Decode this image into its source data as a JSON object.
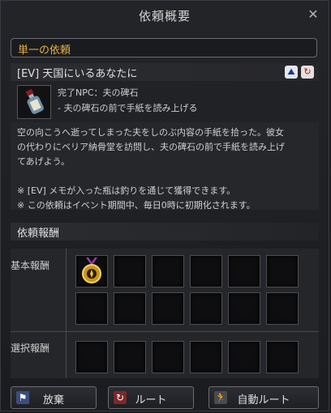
{
  "window": {
    "title": "依頼概要",
    "close_glyph": "✕"
  },
  "quest": {
    "category": "単一の依頼",
    "title": "[EV] 天国にいるあなたに",
    "icons": [
      "route-icon",
      "auto-route-icon"
    ],
    "npc_line": "完了NPC：夫の碑石",
    "task_line": "- 夫の碑石の前で手紙を読み上げる",
    "description_lines": [
      "空の向こうへ逝ってしまった夫をしのぶ内容の手紙を拾った。彼女",
      "の代わりにベリア納骨堂を訪問し、夫の碑石の前で手紙を読み上げ",
      "てあげよう。",
      "",
      "※ [EV] メモが入った瓶は釣りを通じて獲得できます。",
      "※ この依頼はイベント期間中、毎日0時に初期化されます。"
    ]
  },
  "rewards": {
    "title": "依頼報酬",
    "basic_label": "基本報酬",
    "choice_label": "選択報酬",
    "basic_slots": 12,
    "choice_slots": 6,
    "basic_items": [
      "medal-icon"
    ]
  },
  "buttons": {
    "abandon": "放棄",
    "route": "ルート",
    "auto_route": "自動ルート"
  },
  "colors": {
    "accent": "#e8b24a",
    "window": "#1e1f22"
  }
}
